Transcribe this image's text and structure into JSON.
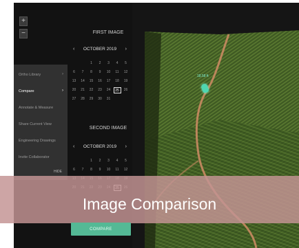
{
  "zoom": {
    "in_label": "+",
    "out_label": "−"
  },
  "menu": {
    "items": [
      {
        "label": "Ortho Library",
        "chevron": "›"
      },
      {
        "label": "Compare",
        "chevron": "›",
        "active": true
      },
      {
        "label": "Annotate & Measure"
      },
      {
        "label": "Share Current View"
      },
      {
        "label": "Engineering Drawings"
      },
      {
        "label": "Invite Collaborator"
      }
    ],
    "hide_label": "HIDE"
  },
  "first_image": {
    "title": "FIRST IMAGE",
    "month_label": "OCTOBER 2019",
    "prev_icon": "‹",
    "next_icon": "›",
    "weeks": [
      [
        "",
        "",
        "1",
        "2",
        "3",
        "4",
        "5"
      ],
      [
        "6",
        "7",
        "8",
        "9",
        "10",
        "11",
        "12"
      ],
      [
        "13",
        "14",
        "15",
        "16",
        "17",
        "18",
        "19"
      ],
      [
        "20",
        "21",
        "22",
        "23",
        "24",
        "25",
        "26"
      ],
      [
        "27",
        "28",
        "29",
        "30",
        "31",
        "",
        ""
      ]
    ],
    "selected_day": "25"
  },
  "second_image": {
    "title": "SECOND IMAGE",
    "month_label": "OCTOBER 2019",
    "prev_icon": "‹",
    "next_icon": "›",
    "weeks": [
      [
        "",
        "",
        "1",
        "2",
        "3",
        "4",
        "5"
      ],
      [
        "6",
        "7",
        "8",
        "9",
        "10",
        "11",
        "12"
      ],
      [
        "13",
        "14",
        "15",
        "16",
        "17",
        "18",
        "19"
      ],
      [
        "20",
        "21",
        "22",
        "23",
        "24",
        "25",
        "26"
      ]
    ],
    "selected_day": "25"
  },
  "map": {
    "label": "18.58 ft"
  },
  "compare_button": "COMPARE",
  "banner": {
    "text": "Image Comparison"
  },
  "colors": {
    "accent": "#54b995",
    "marker": "#4fd6b1",
    "banner": "#c49494"
  }
}
